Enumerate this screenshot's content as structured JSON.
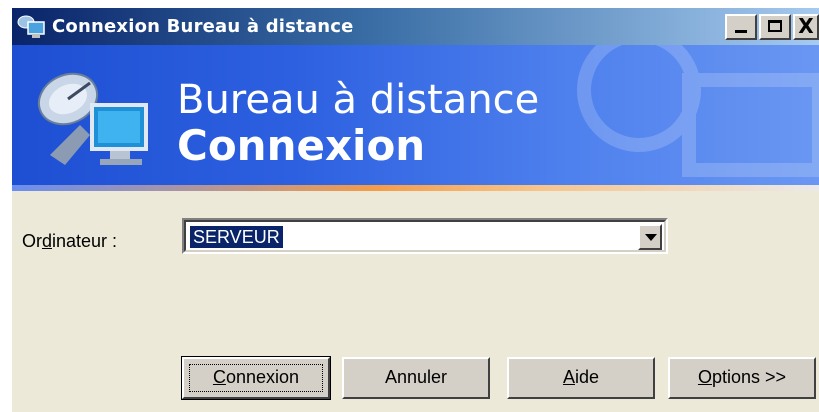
{
  "window": {
    "title": "Connexion Bureau à distance",
    "controls": {
      "minimize": "_",
      "maximize": "□",
      "close": "X"
    }
  },
  "banner": {
    "line1": "Bureau à distance",
    "line2": "Connexion",
    "logo_icon": "satellite-monitor-icon"
  },
  "form": {
    "computer_label_pre": "Or",
    "computer_label_mnemonic": "d",
    "computer_label_post": "inateur :",
    "computer_value": "SERVEUR"
  },
  "buttons": {
    "connect_mnemonic": "C",
    "connect_rest": "onnexion",
    "cancel": "Annuler",
    "help_mnemonic": "A",
    "help_rest": "ide",
    "options_mnemonic": "O",
    "options_rest": "ptions >>"
  },
  "colors": {
    "titlebar_start": "#0a246a",
    "banner_blue": "#2d60e0",
    "dialog_bg": "#ece9d8",
    "selection": "#0a246a"
  }
}
